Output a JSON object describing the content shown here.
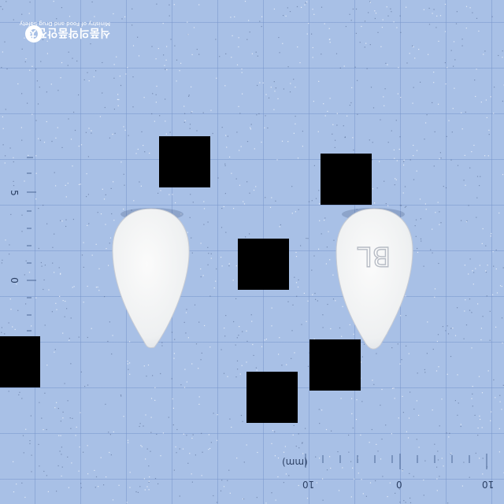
{
  "logo": {
    "korean_text": "식품의약품안전처",
    "english_text": "Ministry of Food and Drug Safety"
  },
  "scale": {
    "vertical_labels": [
      "5",
      "0"
    ],
    "horizontal_labels": [
      "(mm)",
      "10",
      "0",
      "10"
    ]
  },
  "pills": [
    {
      "name": "pill-left",
      "imprint": ""
    },
    {
      "name": "pill-right",
      "imprint": "BL"
    }
  ],
  "colors": {
    "background": "#a8c0e6",
    "grid": "#7896cd",
    "pill": "#f4f5f5",
    "redaction": "#000000"
  }
}
